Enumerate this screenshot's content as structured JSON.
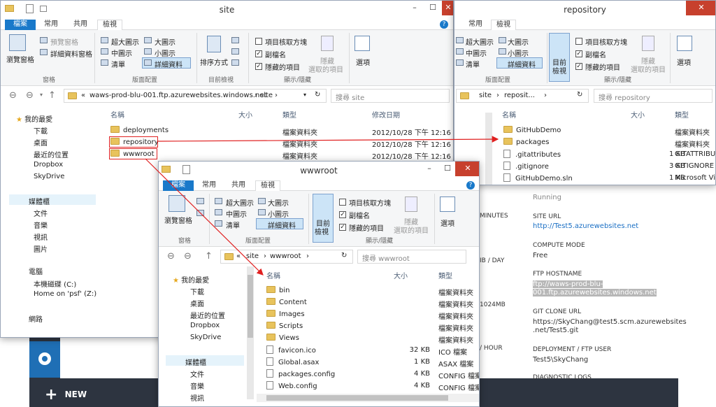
{
  "background": {
    "labels": {
      "minutes": "MINUTES",
      "site_url": "SITE URL",
      "compute_mode": "COMPUTE MODE",
      "ftp_hostname": "FTP HOSTNAME",
      "git_clone_url": "GIT CLONE URL",
      "deployment_user": "DEPLOYMENT / FTP USER",
      "diagnostic_logs": "DIAGNOSTIC LOGS",
      "ib_day": "IB / DAY",
      "mb": "1024MB",
      "hour": "/ HOUR"
    },
    "values": {
      "running": "Running",
      "site_url": "http://Test5.azurewebsites.net",
      "compute_mode": "Free",
      "ftp_line1": "ftp://waws-prod-blu-",
      "ftp_line2": "001.ftp.azurewebsites.windows.net",
      "git_line1": "https://SkyChang@test5.scm.azurewebsites",
      "git_line2": ".net/Test5.git",
      "user": "Test5\\SkyChang"
    },
    "new_label": "NEW",
    "colors": {
      "dark": "#2d3440",
      "blue": "#1a6fc4"
    }
  },
  "win_site": {
    "title": "site",
    "tabs": [
      "檔案",
      "常用",
      "共用",
      "檢視"
    ],
    "ribbon": {
      "nav_pane": "瀏覽窗格",
      "preview": "預覽窗格",
      "details": "詳細資料窗格",
      "pane_group": "窗格",
      "xl": "超大圖示",
      "large": "大圖示",
      "medium": "中圖示",
      "small": "小圖示",
      "list": "清單",
      "detail": "詳細資料",
      "layout_group": "版面配置",
      "sort": "排序方式",
      "view_group": "目前檢視",
      "item_check": "項目核取方塊",
      "ext": "副檔名",
      "hidden": "隱藏的項目",
      "hide_sel1": "隱藏",
      "hide_sel2": "選取的項目",
      "show_group": "顯示/隱藏",
      "options": "選項"
    },
    "address": {
      "parts": [
        "«",
        "waws-prod-blu-001.ftp.azurewebsites.windows.net",
        "›",
        "site",
        "›"
      ]
    },
    "search_placeholder": "搜尋 site",
    "nav": {
      "favorites": "我的最愛",
      "items": [
        "下載",
        "桌面",
        "最近的位置",
        "Dropbox",
        "SkyDrive"
      ],
      "libraries": "媒體櫃",
      "lib_items": [
        "文件",
        "音樂",
        "視訊",
        "圖片"
      ],
      "computer": "電腦",
      "comp_items": [
        "本機磁碟 (C:)",
        "Home on 'psf' (Z:)"
      ],
      "network": "網路"
    },
    "columns": [
      "名稱",
      "大小",
      "類型",
      "修改日期"
    ],
    "rows": [
      {
        "name": "deployments",
        "type": "檔案資料夾",
        "date": "2012/10/28 下午 12:16"
      },
      {
        "name": "repository",
        "type": "檔案資料夾",
        "date": "2012/10/28 下午 12:16"
      },
      {
        "name": "wwwroot",
        "type": "檔案資料夾",
        "date": "2012/10/28 下午 12:16"
      }
    ]
  },
  "win_repo": {
    "title": "repository",
    "tabs": [
      "常用",
      "共用",
      "檢視"
    ],
    "ribbon": {
      "xl": "超大圖示",
      "large": "大圖示",
      "medium": "中圖示",
      "small": "小圖示",
      "list": "清單",
      "detail": "詳細資料",
      "sort1": "目前",
      "sort2": "檢視",
      "item_check": "項目核取方塊",
      "ext": "副檔名",
      "hidden": "隱藏的項目",
      "hide_sel1": "隱藏",
      "hide_sel2": "選取的項目",
      "layout_group": "版面配置",
      "show_group": "顯示/隱藏",
      "options": "選項"
    },
    "address": {
      "parts": [
        "site",
        "›",
        "reposit...",
        "›"
      ]
    },
    "search_placeholder": "搜尋 repository",
    "columns": [
      "名稱",
      "大小",
      "類型"
    ],
    "rows": [
      {
        "name": "GitHubDemo",
        "size": "",
        "type": "檔案資料夾",
        "kind": "folder"
      },
      {
        "name": "packages",
        "size": "",
        "type": "檔案資料夾",
        "kind": "folder"
      },
      {
        "name": ".gitattributes",
        "size": "1 KB",
        "type": "GITATTRIBU",
        "kind": "file"
      },
      {
        "name": ".gitignore",
        "size": "3 KB",
        "type": "GITIGNORE",
        "kind": "file"
      },
      {
        "name": "GitHubDemo.sln",
        "size": "1 KB",
        "type": "Microsoft Vi",
        "kind": "file"
      }
    ]
  },
  "win_www": {
    "title": "wwwroot",
    "tabs": [
      "檔案",
      "常用",
      "共用",
      "檢視"
    ],
    "ribbon": {
      "nav_pane": "瀏覽窗格",
      "pane_group": "窗格",
      "xl": "超大圖示",
      "large": "大圖示",
      "medium": "中圖示",
      "small": "小圖示",
      "list": "清單",
      "detail": "詳細資料",
      "layout_group": "版面配置",
      "sort1": "目前",
      "sort2": "檢視",
      "item_check": "項目核取方塊",
      "ext": "副檔名",
      "hidden": "隱藏的項目",
      "hide_sel1": "隱藏",
      "hide_sel2": "選取的項目",
      "show_group": "顯示/隱藏",
      "options": "選項"
    },
    "address": {
      "parts": [
        "«",
        "site",
        "›",
        "wwwroot",
        "›"
      ]
    },
    "search_placeholder": "搜尋 wwwroot",
    "nav": {
      "favorites": "我的最愛",
      "items": [
        "下載",
        "桌面",
        "最近的位置",
        "Dropbox",
        "SkyDrive"
      ],
      "libraries": "媒體櫃",
      "lib_items": [
        "文件",
        "音樂",
        "視訊"
      ]
    },
    "columns": [
      "名稱",
      "大小",
      "類型"
    ],
    "rows": [
      {
        "name": "bin",
        "size": "",
        "type": "檔案資料夾",
        "kind": "folder"
      },
      {
        "name": "Content",
        "size": "",
        "type": "檔案資料夾",
        "kind": "folder"
      },
      {
        "name": "Images",
        "size": "",
        "type": "檔案資料夾",
        "kind": "folder"
      },
      {
        "name": "Scripts",
        "size": "",
        "type": "檔案資料夾",
        "kind": "folder"
      },
      {
        "name": "Views",
        "size": "",
        "type": "檔案資料夾",
        "kind": "folder"
      },
      {
        "name": "favicon.ico",
        "size": "32 KB",
        "type": "ICO 檔案",
        "kind": "file"
      },
      {
        "name": "Global.asax",
        "size": "1 KB",
        "type": "ASAX 檔案",
        "kind": "file"
      },
      {
        "name": "packages.config",
        "size": "4 KB",
        "type": "CONFIG 檔案",
        "kind": "file"
      },
      {
        "name": "Web.config",
        "size": "4 KB",
        "type": "CONFIG 檔案",
        "kind": "file"
      }
    ]
  }
}
